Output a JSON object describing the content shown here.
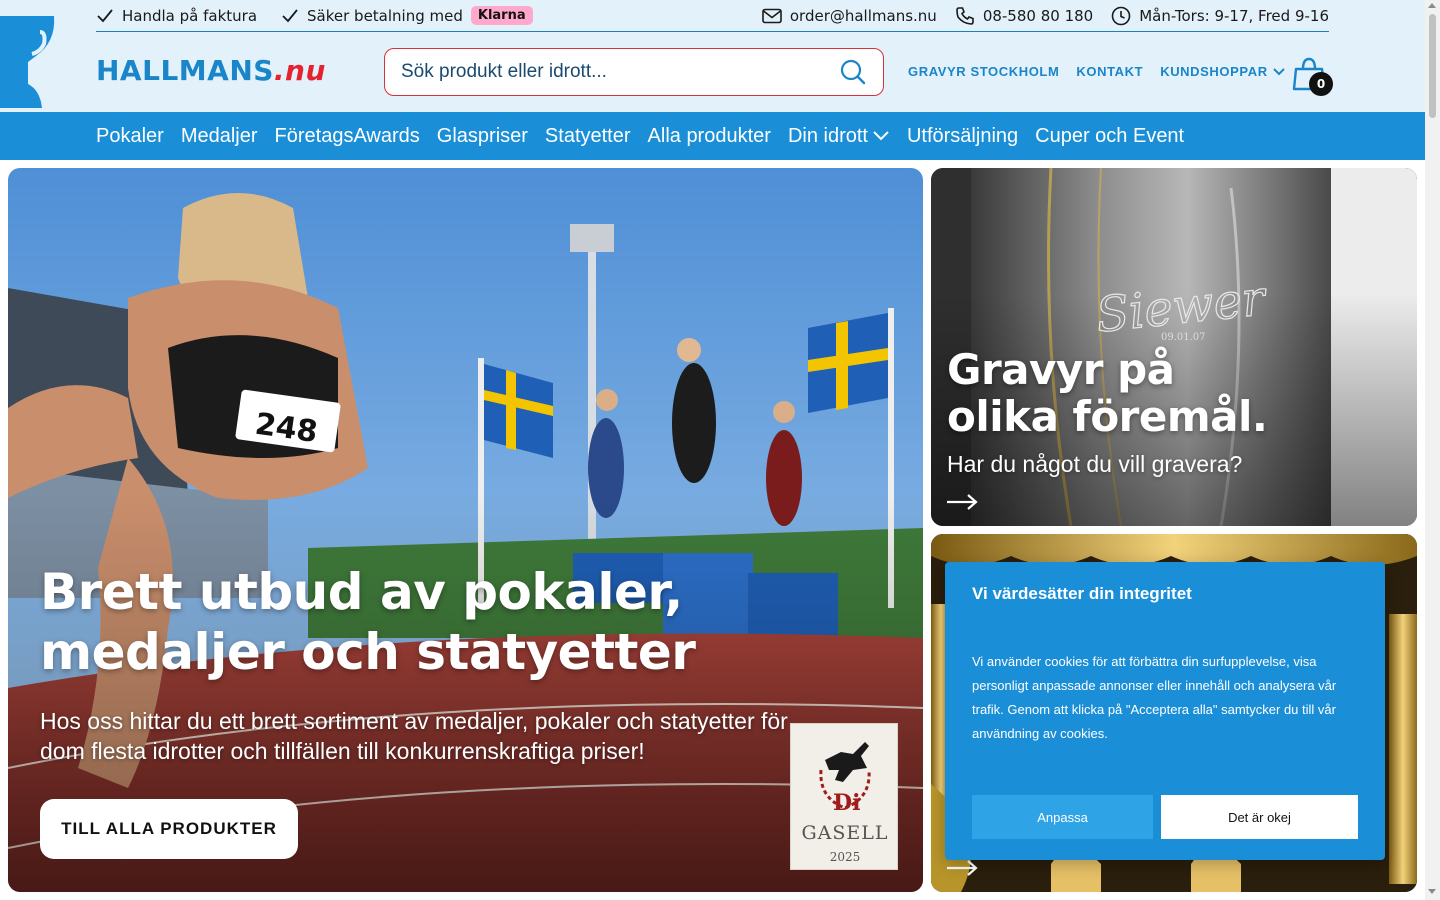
{
  "topbar": {
    "invoice": "Handla på faktura",
    "payment": "Säker betalning med",
    "klarna": "Klarna",
    "email": "order@hallmans.nu",
    "phone": "08-580 80 180",
    "hours": "Mån-Tors: 9-17, Fred 9-16"
  },
  "logo": {
    "main": "HALLMANS",
    "suffix": ".nu"
  },
  "search": {
    "placeholder": "Sök produkt eller idrott..."
  },
  "header_links": {
    "engraving": "GRAVYR STOCKHOLM",
    "contact": "KONTAKT",
    "shops": "KUNDSHOPPAR"
  },
  "cart": {
    "count": "0"
  },
  "nav": [
    {
      "label": "Pokaler"
    },
    {
      "label": "Medaljer"
    },
    {
      "label": "FöretagsAwards"
    },
    {
      "label": "Glaspriser"
    },
    {
      "label": "Statyetter"
    },
    {
      "label": "Alla produkter"
    },
    {
      "label": "Din idrott"
    },
    {
      "label": "Utförsäljning"
    },
    {
      "label": "Cuper och Event"
    }
  ],
  "hero": {
    "title": "Brett utbud av pokaler, medaljer och statyetter",
    "subtitle": "Hos oss hittar du ett brett sortiment av medaljer, pokaler och statyetter för dom flesta idrotter och tillfällen till konkurrenskraftiga priser!",
    "button": "TILL ALLA PRODUKTER",
    "bib_number": "248",
    "badge": {
      "logo": "Di",
      "text": "GASELL",
      "year": "2025"
    }
  },
  "card_engraving": {
    "title_line1": "Gravyr på",
    "title_line2": "olika föremål.",
    "subtitle": "Har du något du vill gravera?",
    "engraved_name": "Siewer",
    "engraved_date": "09.01.07"
  },
  "cookie": {
    "title": "Vi värdesätter din integritet",
    "body": "Vi använder cookies för att förbättra din surfupplevelse, visa personligt anpassade annonser eller innehåll och analysera vår trafik. Genom att klicka på \"Acceptera alla\" samtycker du till vår användning av cookies.",
    "customize": "Anpassa",
    "accept": "Det är okej"
  },
  "colors": {
    "brand_blue": "#1a8fd8",
    "logo_red": "#e4232f",
    "header_bg": "#e3f1fb",
    "klarna_pink": "#ffa8cd"
  }
}
